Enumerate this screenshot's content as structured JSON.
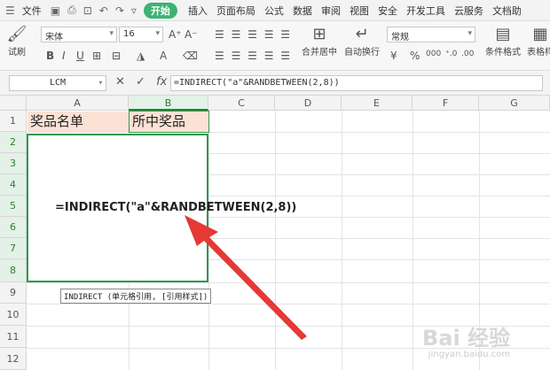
{
  "menu": {
    "items": [
      "文件",
      "开始",
      "插入",
      "页面布局",
      "公式",
      "数据",
      "审阅",
      "视图",
      "安全",
      "开发工具",
      "云服务",
      "文档助"
    ]
  },
  "ribbon": {
    "font_name": "宋体",
    "font_size": "16",
    "merge_center": "合并居中",
    "auto_wrap": "自动换行",
    "number_format": "常规",
    "cond_format": "条件格式",
    "table_style": "表格样",
    "brush_label": "试刷",
    "percent": "%",
    "thousands": "000"
  },
  "formula_bar": {
    "name_box": "LCM",
    "cancel_icon": "✕",
    "accept_icon": "✓",
    "fx": "fx",
    "formula": "=INDIRECT(\"a\"&RANDBETWEEN(2,8))"
  },
  "sheet": {
    "columns": [
      "A",
      "B",
      "C",
      "D",
      "E",
      "F",
      "G"
    ],
    "rows": [
      "1",
      "2",
      "3",
      "4",
      "5",
      "6",
      "7",
      "8",
      "9",
      "10",
      "11",
      "12"
    ],
    "a1": "奖品名单",
    "b1": "所中奖品",
    "editing_formula": "=INDIRECT(\"a\"&RANDBETWEEN(2,8))",
    "tooltip": "INDIRECT (单元格引用, [引用样式])"
  },
  "watermark": {
    "text": "Bai 经验",
    "sub": "jingyan.baidu.com"
  },
  "colors": {
    "accent": "#2e9b4a",
    "header_fill": "#fbe2d5",
    "arrow": "#e53935"
  }
}
